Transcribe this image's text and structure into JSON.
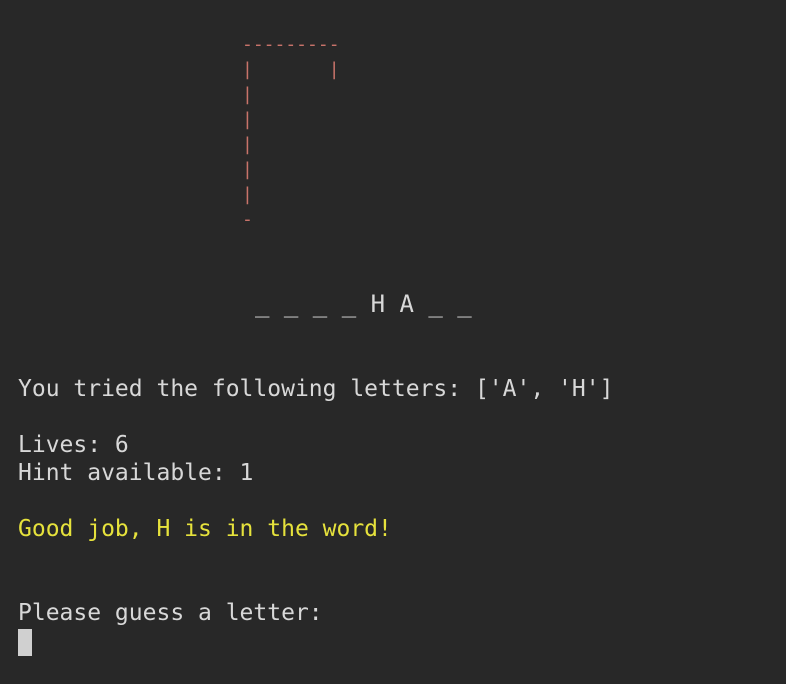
{
  "terminal": {
    "gallows_art": "---------\n|       |\n|\n|\n|\n|\n|\n-",
    "word_display": "_ _ _ _ H A _ _",
    "tried_letters_text": "You tried the following letters: ['A', 'H']",
    "lives_text": "Lives: 6",
    "hint_text": "Hint available: 1",
    "feedback_message": "Good job, H is in the word!",
    "prompt_text": "Please guess a letter:",
    "input_value": ""
  },
  "colors": {
    "background": "#282828",
    "text": "#d8d8d8",
    "gallows": "#c8736a",
    "success_message": "#e6e23c"
  }
}
